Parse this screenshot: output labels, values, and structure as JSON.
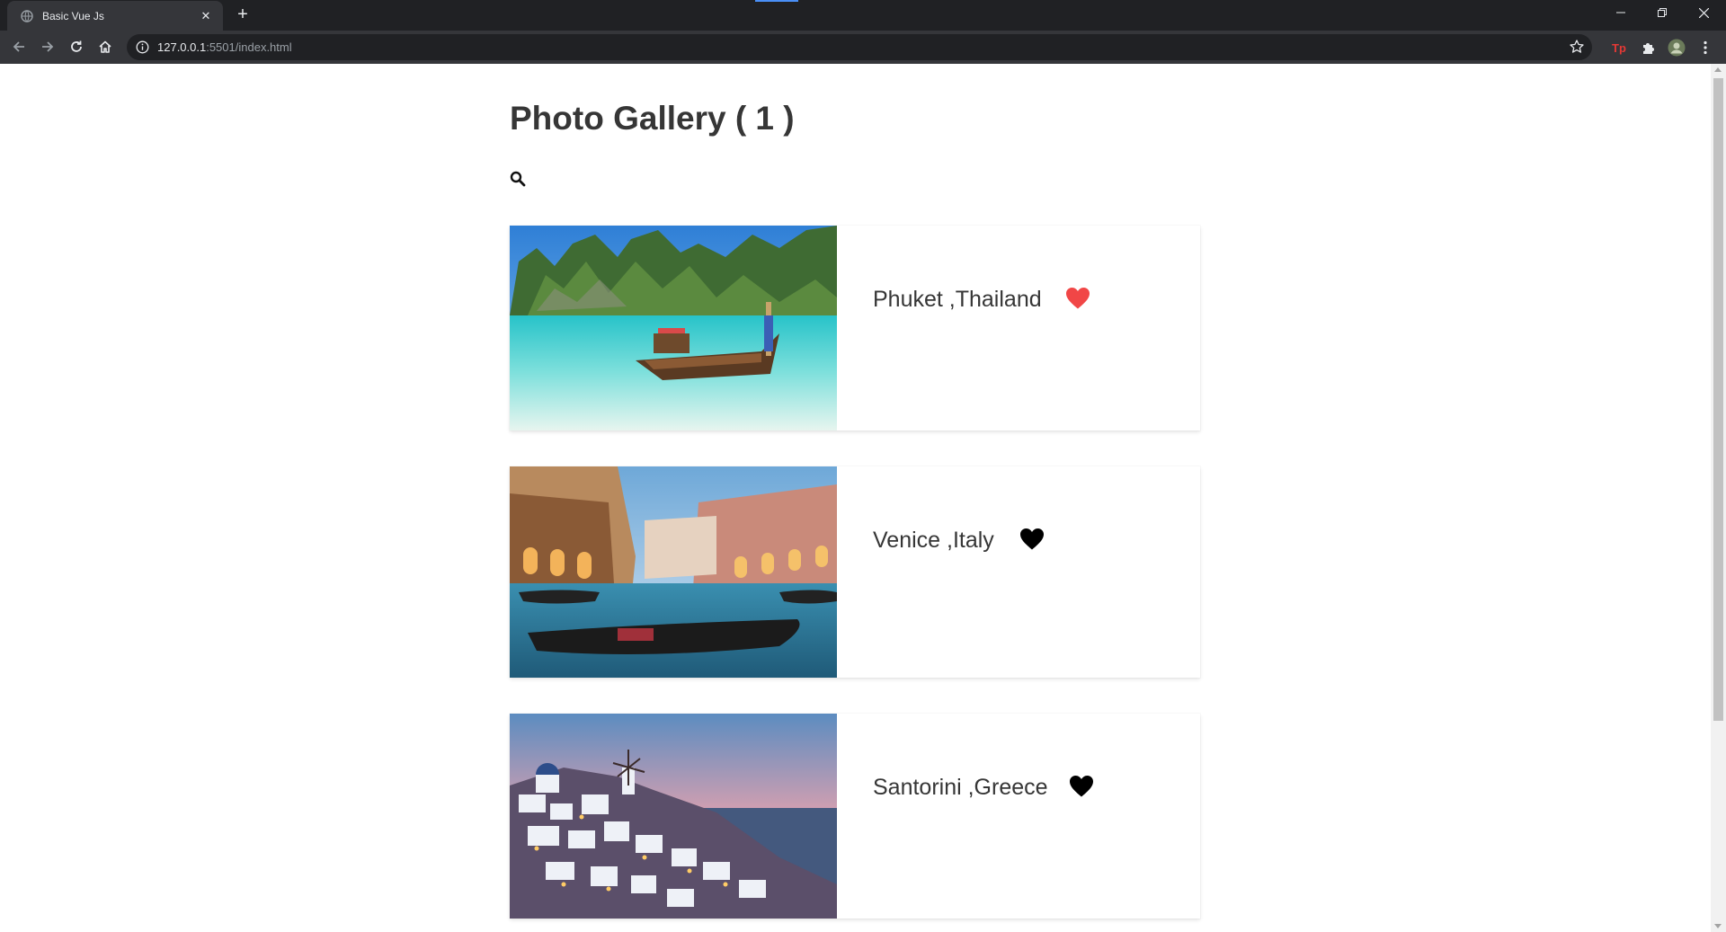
{
  "browser": {
    "tab_title": "Basic Vue Js",
    "close_glyph": "✕",
    "newtab_glyph": "+",
    "url_host": "127.0.0.1",
    "url_path": ":5501/index.html"
  },
  "page": {
    "title": "Photo Gallery ( 1 )",
    "search_placeholder": ""
  },
  "gallery": [
    {
      "place": "Phuket ,Thailand",
      "liked": true,
      "heart_color": "#f14646"
    },
    {
      "place": "Venice ,Italy",
      "liked": false,
      "heart_color": "#000000"
    },
    {
      "place": "Santorini ,Greece",
      "liked": false,
      "heart_color": "#000000"
    }
  ],
  "colors": {
    "chrome_dark": "#202124",
    "chrome_mid": "#35363a",
    "title_text": "#363636",
    "liked_heart": "#f14646"
  }
}
